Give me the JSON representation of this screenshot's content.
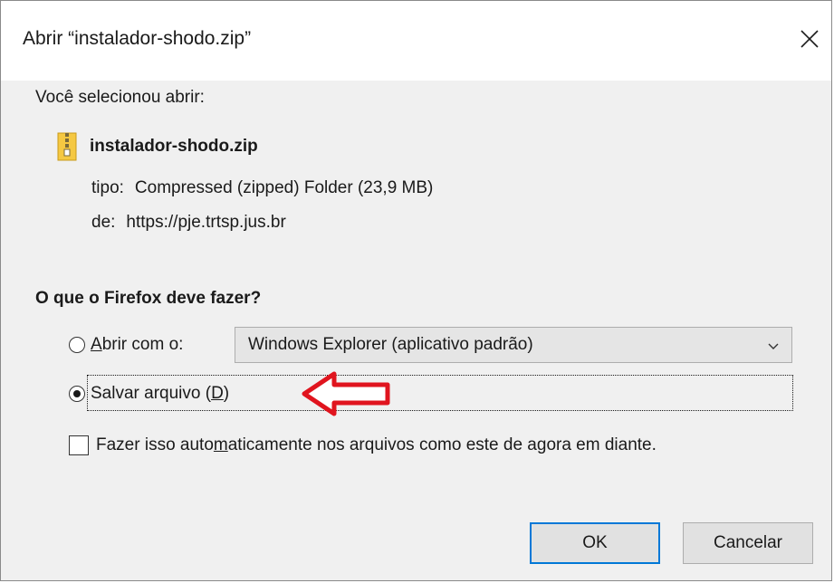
{
  "dialog": {
    "title": "Abrir “instalador-shodo.zip”"
  },
  "content": {
    "intro": "Você selecionou abrir:",
    "file_name": "instalador-shodo.zip",
    "type_key": "tipo:",
    "type_value": "Compressed (zipped) Folder (23,9 MB)",
    "from_key": "de:",
    "from_value": "https://pje.trtsp.jus.br",
    "question": "O que o Firefox deve fazer?"
  },
  "options": {
    "open_with": {
      "prefix": "",
      "accel": "A",
      "rest": "brir com o:",
      "selected": false
    },
    "open_with_app": "Windows Explorer (aplicativo padrão)",
    "save_file": {
      "pre": "Salvar arquivo (",
      "accel": "D",
      "post": ")",
      "selected": true
    },
    "auto": {
      "pre": "Fazer isso auto",
      "accel": "m",
      "post": "aticamente nos arquivos como este de agora em diante.",
      "checked": false
    }
  },
  "buttons": {
    "ok": "OK",
    "cancel": "Cancelar"
  },
  "icons": {
    "close": "close-icon",
    "zip": "zip-file-icon",
    "chevron": "chevron-down-icon",
    "arrow": "red-arrow-annotation"
  },
  "colors": {
    "content_bg": "#f0f0f0",
    "default_button_border": "#0078d7",
    "annotation": "#e0141e"
  }
}
